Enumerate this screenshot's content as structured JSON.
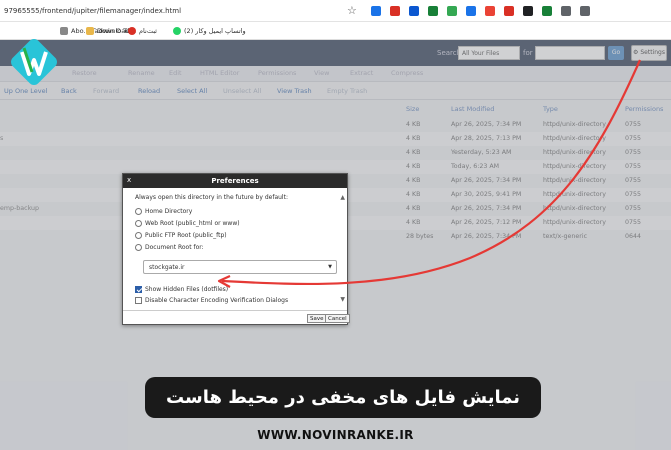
{
  "browser": {
    "url": "97965555/frontend/jupiter/filemanager/index.html",
    "bookmarks": [
      {
        "label": "Abo... Tadwin O Te..."
      },
      {
        "label": "Download"
      },
      {
        "label": "ثبت‌نام"
      },
      {
        "label": "واتساپ ایمیل وکار (2)"
      }
    ],
    "extension_colors": [
      "#1a73e8",
      "#d93025",
      "#0b57d0",
      "#188038",
      "#34a853",
      "#1a73e8",
      "#ea4335",
      "#d93025",
      "#202124",
      "#188038",
      "#5f6368",
      "#5f6368"
    ]
  },
  "header": {
    "search_label": "Search",
    "search_scope": "All Your Files",
    "for_label": "for",
    "go_label": "Go",
    "settings_label": "Settings"
  },
  "toolbar_top": [
    {
      "label": "Restore"
    },
    {
      "label": "Rename"
    },
    {
      "label": "Edit"
    },
    {
      "label": "HTML Editor"
    },
    {
      "label": "Permissions"
    },
    {
      "label": "View"
    },
    {
      "label": "Extract"
    },
    {
      "label": "Compress"
    }
  ],
  "toolbar_nav": [
    {
      "label": "Up One Level",
      "enabled": true
    },
    {
      "label": "Back",
      "enabled": true
    },
    {
      "label": "Forward",
      "enabled": false
    },
    {
      "label": "Reload",
      "enabled": true
    },
    {
      "label": "Select All",
      "enabled": true
    },
    {
      "label": "Unselect All",
      "enabled": false
    },
    {
      "label": "View Trash",
      "enabled": true
    },
    {
      "label": "Empty Trash",
      "enabled": false
    }
  ],
  "columns": [
    "Size",
    "Last Modified",
    "Type",
    "Permissions"
  ],
  "files": [
    {
      "name": "",
      "size": "4 KB",
      "modified": "Apr 26, 2025, 7:34 PM",
      "type": "httpd/unix-directory",
      "perms": "0755"
    },
    {
      "name": "s",
      "size": "4 KB",
      "modified": "Apr 28, 2025, 7:13 PM",
      "type": "httpd/unix-directory",
      "perms": "0755"
    },
    {
      "name": "",
      "size": "4 KB",
      "modified": "Yesterday, 5:23 AM",
      "type": "httpd/unix-directory",
      "perms": "0755"
    },
    {
      "name": "",
      "size": "4 KB",
      "modified": "Today, 6:23 AM",
      "type": "httpd/unix-directory",
      "perms": "0755"
    },
    {
      "name": "",
      "size": "4 KB",
      "modified": "Apr 26, 2025, 7:34 PM",
      "type": "httpd/unix-directory",
      "perms": "0755"
    },
    {
      "name": "",
      "size": "4 KB",
      "modified": "Apr 30, 2025, 9:41 PM",
      "type": "httpd/unix-directory",
      "perms": "0755"
    },
    {
      "name": "emp-backup",
      "size": "4 KB",
      "modified": "Apr 26, 2025, 7:34 PM",
      "type": "httpd/unix-directory",
      "perms": "0755"
    },
    {
      "name": "",
      "size": "4 KB",
      "modified": "Apr 26, 2025, 7:12 PM",
      "type": "httpd/unix-directory",
      "perms": "0755"
    },
    {
      "name": "",
      "size": "28 bytes",
      "modified": "Apr 26, 2025, 7:34 PM",
      "type": "text/x-generic",
      "perms": "0644"
    }
  ],
  "dialog": {
    "title": "Preferences",
    "close": "x",
    "intro": "Always open this directory in the future by default:",
    "radios": [
      {
        "label": "Home Directory"
      },
      {
        "label": "Web Root (public_html or www)"
      },
      {
        "label": "Public FTP Root (public_ftp)"
      },
      {
        "label": "Document Root for:"
      }
    ],
    "domain": "stockgate.ir",
    "checkbox_hidden": "Show Hidden Files (dotfiles)",
    "checkbox_hidden_checked": true,
    "checkbox_encoding": "Disable Character Encoding Verification Dialogs",
    "checkbox_encoding_checked": false,
    "save_label": "Save",
    "cancel_label": "Cancel"
  },
  "banner": {
    "title": "نمایش فایل های مخفی در محیط هاست",
    "site": "WWW.NOVINRANKE.IR"
  },
  "colors": {
    "header_bg": "#2a3a52",
    "link_blue": "#3d6db0",
    "arrow_red": "#e53935",
    "logo_cyan": "#29c4d8",
    "logo_green": "#26b34a"
  }
}
